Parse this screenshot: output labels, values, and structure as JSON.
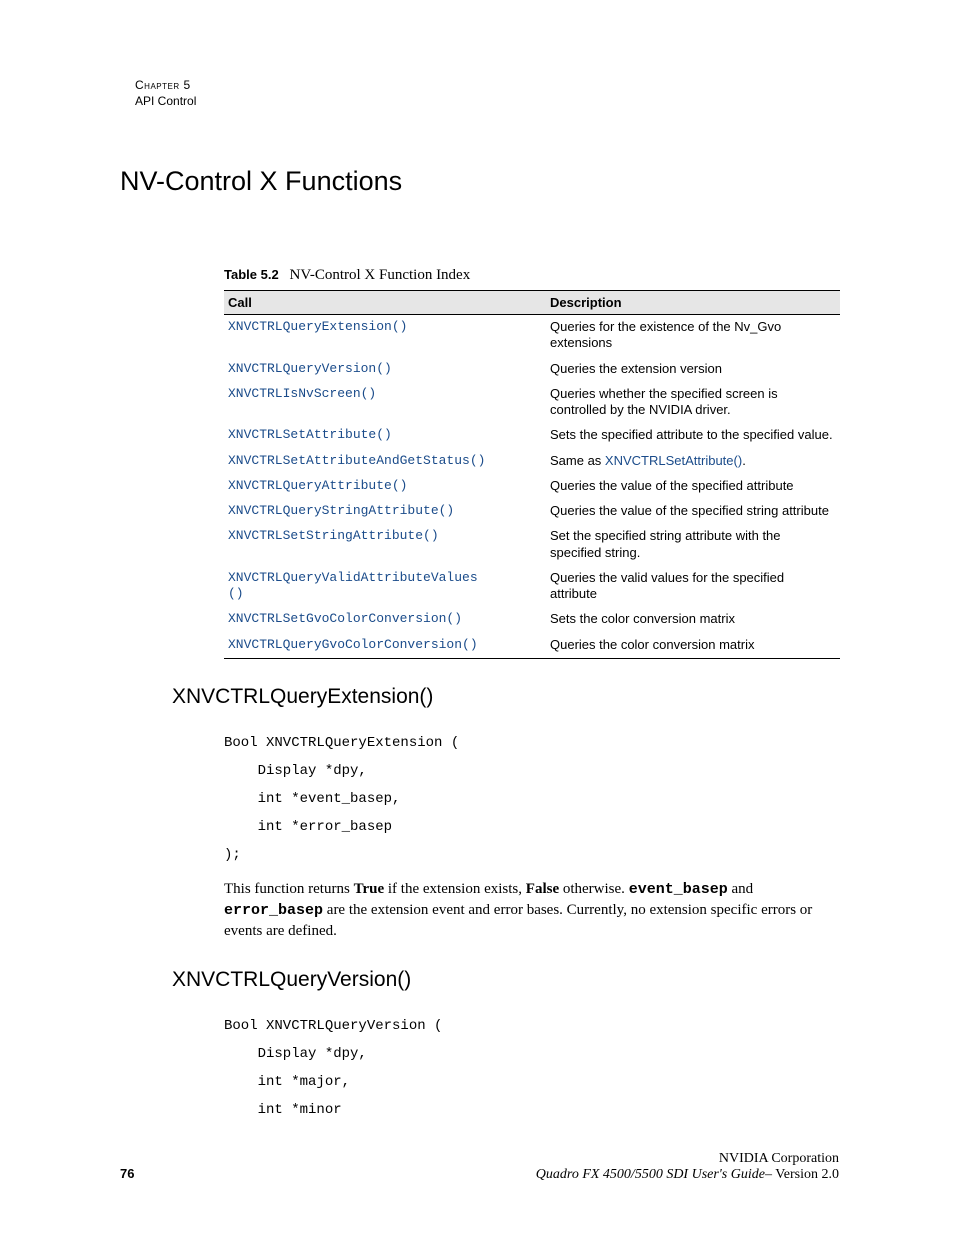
{
  "header": {
    "chapter": "Chapter 5",
    "subtitle": "API Control"
  },
  "title": "NV-Control X Functions",
  "tableCaption": {
    "label": "Table 5.2",
    "text": "NV-Control X Function Index"
  },
  "tableHeaders": {
    "call": "Call",
    "desc": "Description"
  },
  "rows": [
    {
      "call": "XNVCTRLQueryExtension()",
      "desc": "Queries for the existence of the Nv_Gvo extensions"
    },
    {
      "call": "XNVCTRLQueryVersion()",
      "desc": "Queries the extension version"
    },
    {
      "call": "XNVCTRLIsNvScreen()",
      "desc": "Queries whether the specified screen is controlled by the NVIDIA driver."
    },
    {
      "call": "XNVCTRLSetAttribute()",
      "desc": "Sets the specified attribute to the specified value."
    },
    {
      "call": "XNVCTRLSetAttributeAndGetStatus()",
      "descPre": "Same as ",
      "descLink": "XNVCTRLSetAttribute()",
      "descPost": "."
    },
    {
      "call": "XNVCTRLQueryAttribute()",
      "desc": "Queries the value of the specified attribute"
    },
    {
      "call": "XNVCTRLQueryStringAttribute()",
      "desc": "Queries the value of the specified string attribute"
    },
    {
      "call": "XNVCTRLSetStringAttribute()",
      "desc": "Set the specified string attribute with the specified string."
    },
    {
      "call": "XNVCTRLQueryValidAttributeValues()",
      "desc": "Queries the valid values for the specified attribute"
    },
    {
      "call": "XNVCTRLSetGvoColorConversion()",
      "desc": "Sets the color conversion matrix"
    },
    {
      "call": "XNVCTRLQueryGvoColorConversion()",
      "desc": "Queries the color conversion matrix"
    }
  ],
  "sec1": {
    "heading": "XNVCTRLQueryExtension()",
    "code": "Bool XNVCTRLQueryExtension (\n    Display *dpy,\n    int *event_basep,\n    int *error_basep\n);",
    "body": {
      "p1": "This function returns ",
      "b1": "True",
      "p2": " if the extension exists, ",
      "b2": "False",
      "p3": " otherwise. ",
      "m1": "event_basep",
      "p4": " and ",
      "m2": "error_basep",
      "p5": " are the extension event and error bases.  Currently, no extension specific errors or events are  defined."
    }
  },
  "sec2": {
    "heading": "XNVCTRLQueryVersion()",
    "code": "Bool XNVCTRLQueryVersion (\n    Display *dpy,\n    int *major,\n    int *minor"
  },
  "footer": {
    "page": "76",
    "corp": "NVIDIA Corporation",
    "guide": "Quadro FX 4500/5500 SDI User's Guide",
    "ver": "– Version 2.0"
  }
}
